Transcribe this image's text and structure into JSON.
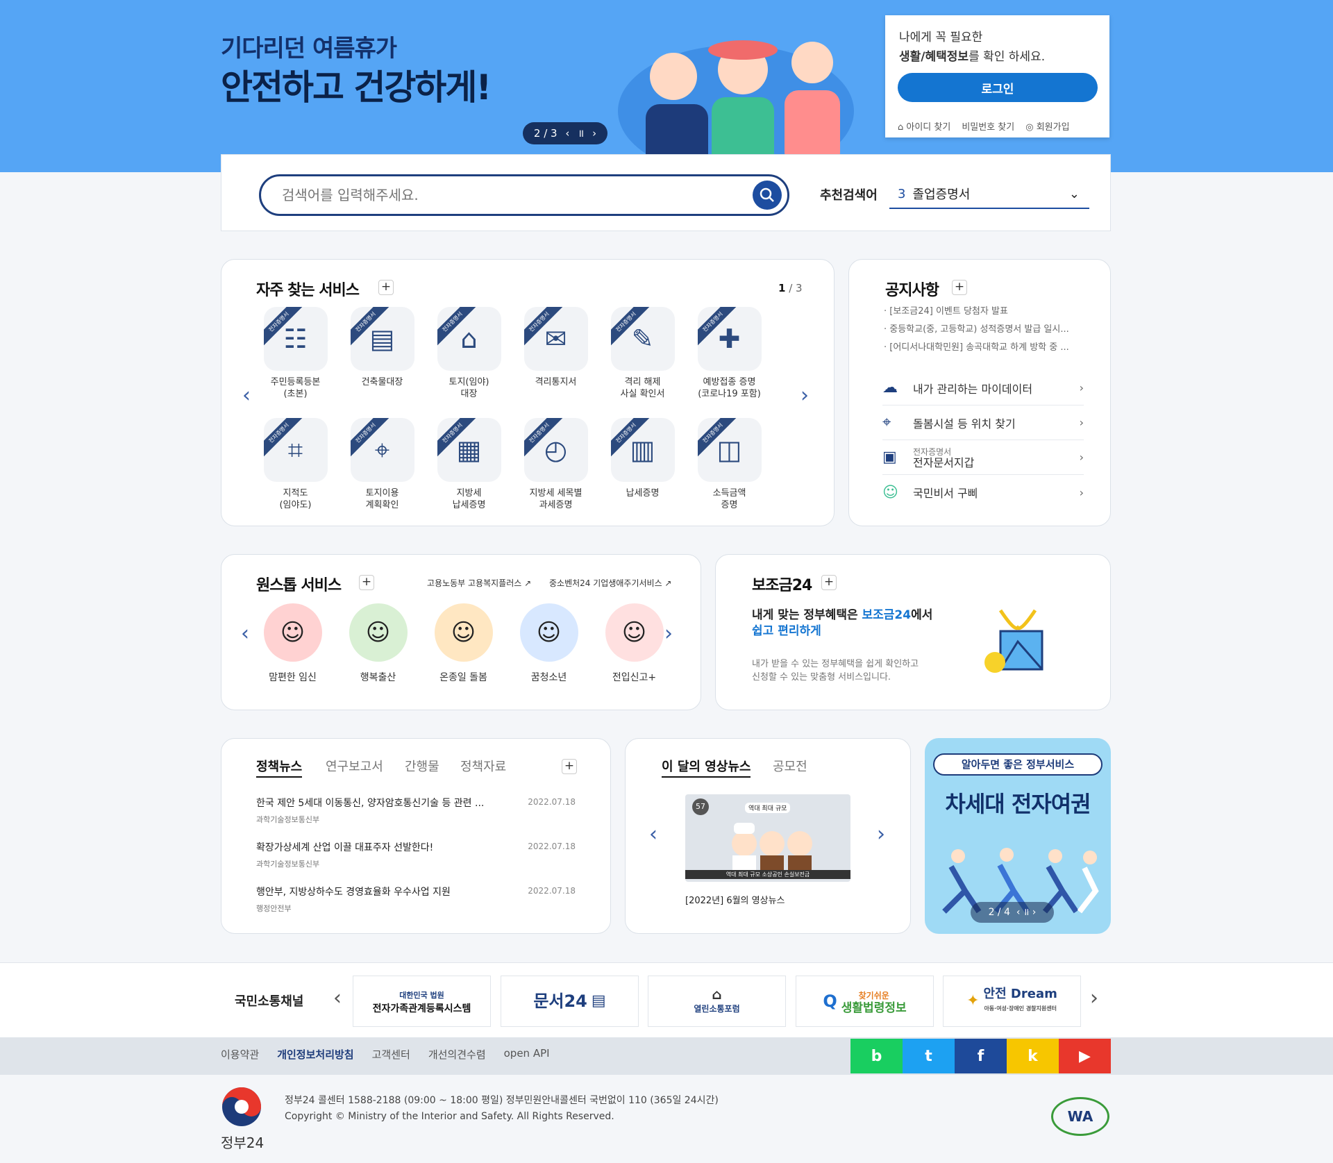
{
  "hero": {
    "title_line1": "기다리던 여름휴가",
    "title_line2": "안전하고 건강하게!",
    "pager": "2 / 3",
    "prev": "‹",
    "pause": "॥",
    "next": "›"
  },
  "login": {
    "line1": "나에게 꼭 필요한",
    "line2_bold": "생활/혜택정보",
    "line2_rest": "를 확인 하세요.",
    "button": "로그인",
    "links": [
      "아이디 찾기",
      "비밀번호 찾기",
      "회원가입"
    ]
  },
  "search": {
    "placeholder": "검색어를 입력해주세요.",
    "rec_label": "추천검색어",
    "rec_rank": "3",
    "rec_value": "졸업증명서"
  },
  "frequent": {
    "title": "자주 찾는 서비스",
    "page_current": "1",
    "page_total": "/ 3",
    "ribbon": "전자증명서",
    "items": [
      {
        "l1": "주민등록등본",
        "l2": "(초본)"
      },
      {
        "l1": "건축물대장",
        "l2": ""
      },
      {
        "l1": "토지(임야)",
        "l2": "대장"
      },
      {
        "l1": "격리통지서",
        "l2": ""
      },
      {
        "l1": "격리 해제",
        "l2": "사실 확인서"
      },
      {
        "l1": "예방접종 증명",
        "l2": "(코로나19 포함)"
      },
      {
        "l1": "지적도",
        "l2": "(임야도)"
      },
      {
        "l1": "토지이용",
        "l2": "계획확인"
      },
      {
        "l1": "지방세",
        "l2": "납세증명"
      },
      {
        "l1": "지방세 세목별",
        "l2": "과세증명"
      },
      {
        "l1": "납세증명",
        "l2": ""
      },
      {
        "l1": "소득금액",
        "l2": "증명"
      }
    ]
  },
  "notice": {
    "title": "공지사항",
    "items": [
      "[보조금24] 이벤트 당첨자 발표",
      "중등학교(중, 고등학교) 성적증명서 발급 일시...",
      "[어디서나대학민원] 송곡대학교 하계 방학 중 ..."
    ],
    "links": [
      {
        "small": "",
        "label": "내가 관리하는 마이데이터"
      },
      {
        "small": "",
        "label": "돌봄시설 등 위치 찾기"
      },
      {
        "small": "전자증명서",
        "label": "전자문서지갑"
      },
      {
        "small": "",
        "label": "국민비서 구삐"
      }
    ]
  },
  "onestop": {
    "title": "원스톱 서비스",
    "link1": "고용노동부 고용복지플러스 ↗",
    "link2": "중소벤처24 기업생애주기서비스 ↗",
    "items": [
      "맘편한 임신",
      "행복출산",
      "온종일 돌봄",
      "꿈청소년",
      "전입신고+"
    ]
  },
  "subsidy": {
    "title": "보조금24",
    "h1": "내게 맞는 정부혜택은 ",
    "h1_blue": "보조금24",
    "h1_end": "에서",
    "h2_blue": "쉽고 편리하게",
    "desc1": "내가 받을 수 있는 정부혜택을 쉽게 확인하고",
    "desc2": "신청할 수 있는 맞춤형 서비스입니다."
  },
  "news": {
    "tabs": [
      "정책뉴스",
      "연구보고서",
      "간행물",
      "정책자료"
    ],
    "items": [
      {
        "title": "한국 제안 5세대 이동통신, 양자암호통신기술 등 관련 ...",
        "source": "과학기술정보통신부",
        "date": "2022.07.18"
      },
      {
        "title": "확장가상세계 산업 이끌 대표주자 선발한다!",
        "source": "과학기술정보통신부",
        "date": "2022.07.18"
      },
      {
        "title": "행안부, 지방상하수도 경영효율화 우수사업 지원",
        "source": "행정안전부",
        "date": "2022.07.18"
      }
    ]
  },
  "video": {
    "tabs": [
      "이 달의 영상뉴스",
      "공모전"
    ],
    "caption": "[2022년] 6월의 영상뉴스",
    "thumb_text": "역대 최대 규모",
    "thumb_bottom": "역대 최대 규모 소상공인 손실보전금",
    "thumb_badge": "57"
  },
  "banner": {
    "badge": "알아두면 좋은 정부서비스",
    "title": "차세대 전자여권",
    "pager": "2 / 4"
  },
  "channels": {
    "title": "국민소통채널",
    "items": [
      {
        "l1": "대한민국 법원",
        "l2": "전자가족관계등록시스템"
      },
      {
        "l1": "문서24",
        "l2": ""
      },
      {
        "l1": "열린소통포럼",
        "l2": ""
      },
      {
        "l1": "찾기쉬운",
        "l2": "생활법령정보"
      },
      {
        "l1": "안전 Dream",
        "l2": "아동·여성·장애인 경찰지원센터"
      }
    ]
  },
  "footer": {
    "links": [
      "이용약관",
      "개인정보처리방침",
      "고객센터",
      "개선의견수렴",
      "open API"
    ],
    "sns": [
      "b",
      "t",
      "f",
      "k",
      "▶"
    ],
    "sns_colors": [
      "#19ce60",
      "#1da1f2",
      "#1e4a9a",
      "#f7c600",
      "#e8372c"
    ],
    "line1": "정부24 콜센터 1588-2188 (09:00 ~ 18:00 평일) 정부민원안내콜센터 국번없이 110 (365일 24시간)",
    "line2": "Copyright © Ministry of the Interior and Safety. All Rights Reserved.",
    "logo_text": "정부24",
    "wa_text": "WA"
  },
  "colors": {
    "hero_bg": "#55a5f5",
    "primary": "#1475d1",
    "navy": "#1e3f7e"
  }
}
